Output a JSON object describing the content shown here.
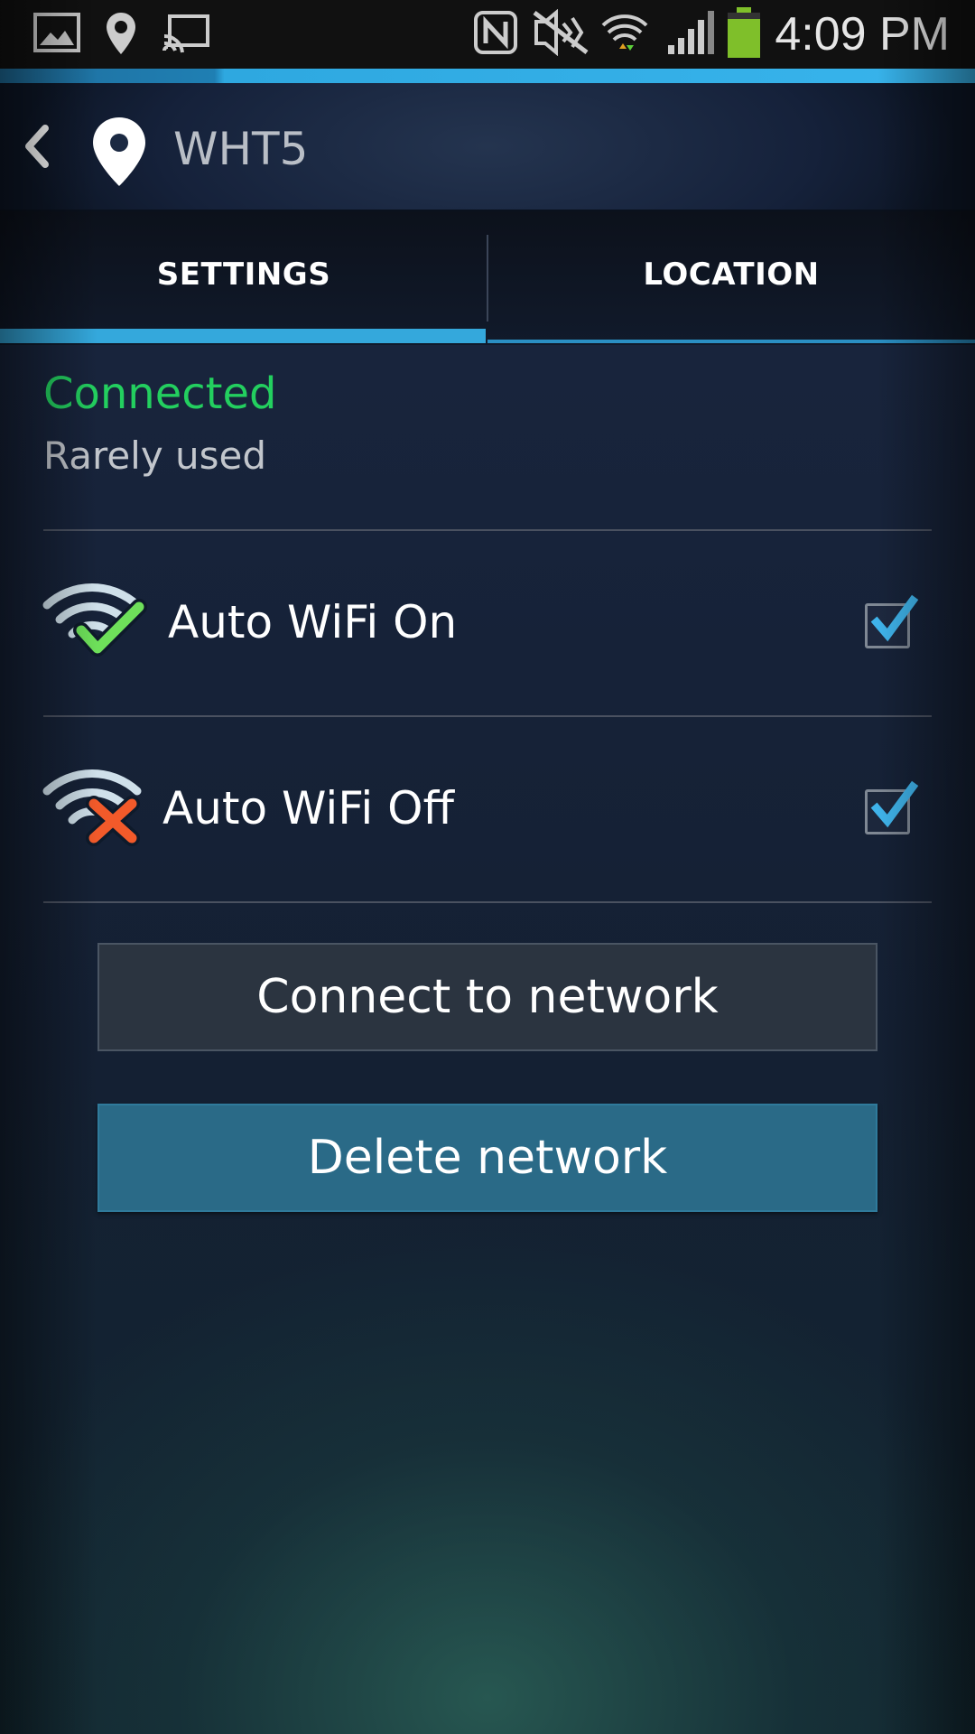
{
  "status_bar": {
    "time": "4:09 PM",
    "icons": [
      "gallery-icon",
      "location-icon",
      "cast-icon",
      "nfc-icon",
      "mute-icon",
      "wifi-icon",
      "cell-signal-icon",
      "battery-icon"
    ],
    "battery_level": 0.85
  },
  "action_bar": {
    "title": "WHT5",
    "back_icon": "back-chevron-icon",
    "location_icon": "location-pin-icon"
  },
  "tabs": [
    {
      "label": "SETTINGS",
      "selected": true
    },
    {
      "label": "LOCATION",
      "selected": false
    }
  ],
  "network_status": {
    "status": "Connected",
    "usage": "Rarely used",
    "status_color": "#23cf5f"
  },
  "settings": [
    {
      "label": "Auto WiFi On",
      "icon": "wifi-check-icon",
      "checked": true
    },
    {
      "label": "Auto WiFi Off",
      "icon": "wifi-x-icon",
      "checked": true
    }
  ],
  "buttons": {
    "connect": "Connect to network",
    "delete": "Delete network"
  },
  "colors": {
    "accent": "#34a8dc",
    "check": "#3fb3ea",
    "wifi_on_check": "#6ee05a",
    "wifi_off_x": "#f25a2a",
    "delete_button": "#2a6a87"
  }
}
